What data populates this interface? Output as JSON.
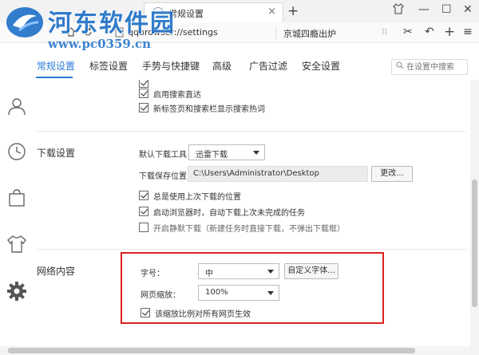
{
  "watermark": {
    "name": "河东软件园",
    "url": "www.pc0359.cn"
  },
  "browser": {
    "tab_title": "常规设置",
    "tab_close": "×",
    "new_tab": "+",
    "url": "qqbrowser://settings",
    "search_engine_text": "京城四瘾出炉",
    "grip": "⁞⁞",
    "tools": {
      "scissors": "✂",
      "undo": "↶",
      "add": "+",
      "menu": "≡"
    },
    "window": {
      "shirt": "👕",
      "minimize": "—",
      "maximize": "☐",
      "close": "✕"
    }
  },
  "nav": {
    "tabs": [
      {
        "label": "常规设置",
        "active": true
      },
      {
        "label": "标签设置",
        "active": false
      },
      {
        "label": "手势与快捷键",
        "active": false
      },
      {
        "label": "高级",
        "active": false
      },
      {
        "label": "广告过滤",
        "active": false
      },
      {
        "label": "安全设置",
        "active": false
      }
    ],
    "search_placeholder": "在设置中搜索"
  },
  "sidebar": {
    "icons": [
      "user-icon",
      "history-clock-icon",
      "bag-icon",
      "tshirt-icon",
      "gear-icon"
    ]
  },
  "top_options": [
    {
      "label": "启用搜索直达",
      "checked": true
    },
    {
      "label": "新标签页和搜索栏显示搜索热词",
      "checked": true
    }
  ],
  "download": {
    "section_title": "下载设置",
    "default_tool_label": "默认下载工具",
    "default_tool_value": "迅雷下载",
    "save_location_label": "下载保存位置",
    "save_location_value": "C:\\Users\\Administrator\\Desktop",
    "change_button": "更改...",
    "options": [
      {
        "label": "总是使用上次下载的位置",
        "checked": true
      },
      {
        "label": "启动浏览器时，自动下载上次未完成的任务",
        "checked": true
      },
      {
        "label": "开启静默下载（新建任务时直接下载，不弹出下载框）",
        "checked": false
      }
    ]
  },
  "web_content": {
    "section_title": "网络内容",
    "font_size_label": "字号：",
    "font_size_value": "中",
    "custom_font_button": "自定义字体...",
    "zoom_label": "网页缩放：",
    "zoom_value": "100%",
    "zoom_all_pages": {
      "label": "该缩放比例对所有网页生效",
      "checked": true
    }
  },
  "colors": {
    "accent": "#2b7ad6",
    "highlight_box": "#e02020",
    "watermark": "#1c6fc7"
  }
}
